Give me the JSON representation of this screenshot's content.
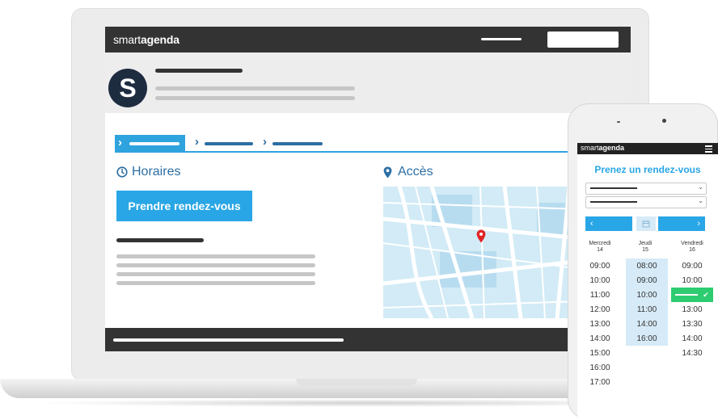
{
  "laptop": {
    "brand_light": "smart",
    "brand_bold": "agenda",
    "logo_letter": "S",
    "horaires_label": "Horaires",
    "acces_label": "Accès",
    "book_button": "Prendre rendez-vous",
    "clock_icon": "clock-icon",
    "pin_icon": "location-pin-icon"
  },
  "phone": {
    "brand_light": "smart",
    "brand_bold": "agenda",
    "title": "Prenez un rendez-vous",
    "prev": "‹",
    "next": "›",
    "calendar_icon": "calendar-icon",
    "days": [
      {
        "name": "Mercredi",
        "num": "14"
      },
      {
        "name": "Jeudi",
        "num": "15"
      },
      {
        "name": "Vendredi",
        "num": "16"
      }
    ],
    "col1": [
      "09:00",
      "10:00",
      "11:00",
      "12:00",
      "13:00",
      "14:00",
      "15:00",
      "16:00",
      "17:00"
    ],
    "col2": [
      "08:00",
      "09:00",
      "10:00",
      "11:00",
      "14:00",
      "16:00"
    ],
    "col3": [
      "09:00",
      "10:00",
      "",
      "13:00",
      "13:30",
      "14:00",
      "14:30"
    ]
  },
  "colors": {
    "accent": "#29a6e6",
    "dark_blue": "#2c6ea3",
    "bar": "#333333",
    "success": "#2ecc71"
  }
}
